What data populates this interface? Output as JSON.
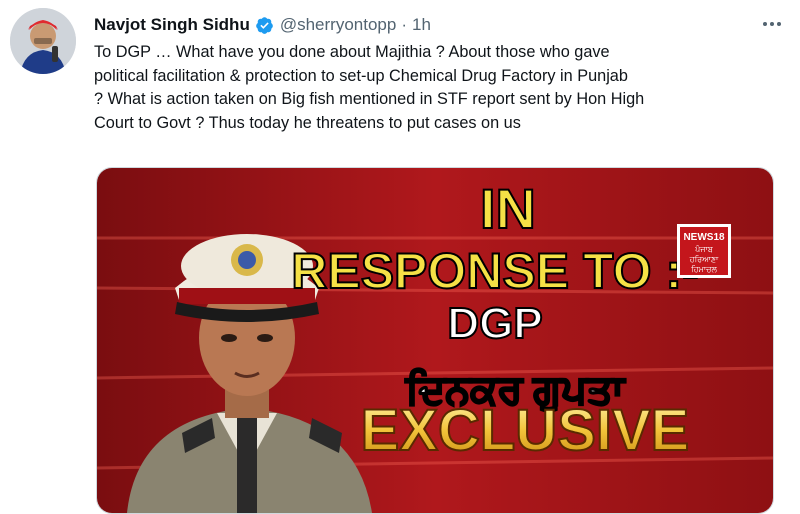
{
  "tweet": {
    "author_name": "Navjot Singh Sidhu",
    "handle": "@sherryontopp",
    "separator": "·",
    "time": "1h",
    "more_icon": "more-horizontal-icon",
    "verified_icon": "verified-badge-icon",
    "text": "To DGP … What have you done about Majithia ? About those who gave\npolitical facilitation & protection to set-up Chemical Drug Factory in Punjab\n? What is action taken on Big fish mentioned in STF report sent by Hon High\nCourt to Govt ? Thus today he threatens to put cases on us"
  },
  "media": {
    "line1": "IN",
    "line2": "RESPONSE TO :-",
    "line3": "DGP",
    "line4": "ਦਿਨਕਰ ਗੁਪਤਾ",
    "line5": "EXCLUSIVE",
    "logo_top": "NEWS18",
    "logo_line2": "ਪੰਜਾਬ",
    "logo_line3": "ਹਰਿਆਣਾ",
    "logo_line4": "ਹਿਮਾਚਲ"
  },
  "colors": {
    "accent_blue": "#1d9bf0",
    "headline_yellow": "#f5e146",
    "media_red": "#b0181c"
  }
}
